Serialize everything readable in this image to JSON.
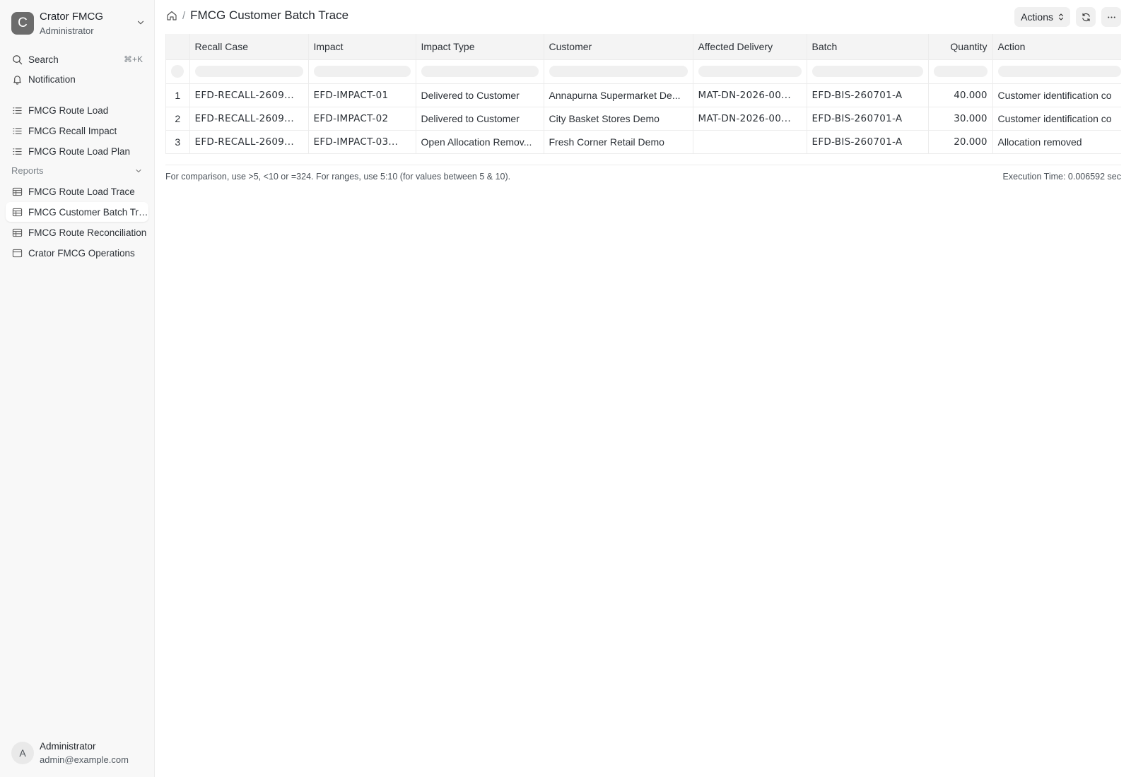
{
  "workspace": {
    "logo_letter": "C",
    "name": "Crator FMCG",
    "role": "Administrator"
  },
  "sidebar": {
    "search_label": "Search",
    "search_shortcut": "⌘+K",
    "notification_label": "Notification",
    "items": [
      {
        "label": "FMCG Route Load"
      },
      {
        "label": "FMCG Recall Impact"
      },
      {
        "label": "FMCG Route Load Plan"
      }
    ],
    "reports_label": "Reports",
    "reports": [
      {
        "label": "FMCG Route Load Trace"
      },
      {
        "label": "FMCG Customer Batch Trace",
        "active": true
      },
      {
        "label": "FMCG Route Reconciliation"
      },
      {
        "label": "Crator FMCG Operations"
      }
    ]
  },
  "user": {
    "initial": "A",
    "name": "Administrator",
    "email": "admin@example.com"
  },
  "header": {
    "separator": "/",
    "title": "FMCG Customer Batch Trace",
    "actions_label": "Actions"
  },
  "table": {
    "columns": [
      "Recall Case",
      "Impact",
      "Impact Type",
      "Customer",
      "Affected Delivery",
      "Batch",
      "Quantity",
      "Action"
    ],
    "rows": [
      {
        "idx": "1",
        "cells": [
          "EFD-RECALL-2609...",
          "EFD-IMPACT-01",
          "Delivered to Customer",
          "Annapurna Supermarket De...",
          "MAT-DN-2026-00...",
          "EFD-BIS-260701-A",
          "40.000",
          "Customer identification co"
        ]
      },
      {
        "idx": "2",
        "cells": [
          "EFD-RECALL-2609...",
          "EFD-IMPACT-02",
          "Delivered to Customer",
          "City Basket Stores Demo",
          "MAT-DN-2026-00...",
          "EFD-BIS-260701-A",
          "30.000",
          "Customer identification co"
        ]
      },
      {
        "idx": "3",
        "cells": [
          "EFD-RECALL-2609...",
          "EFD-IMPACT-03...",
          "Open Allocation Remov...",
          "Fresh Corner Retail Demo",
          "",
          "EFD-BIS-260701-A",
          "20.000",
          "Allocation removed"
        ]
      }
    ]
  },
  "footer": {
    "hint": "For comparison, use >5, <10 or =324. For ranges, use 5:10 (for values between 5 & 10).",
    "execution_time": "Execution Time: 0.006592 sec"
  }
}
